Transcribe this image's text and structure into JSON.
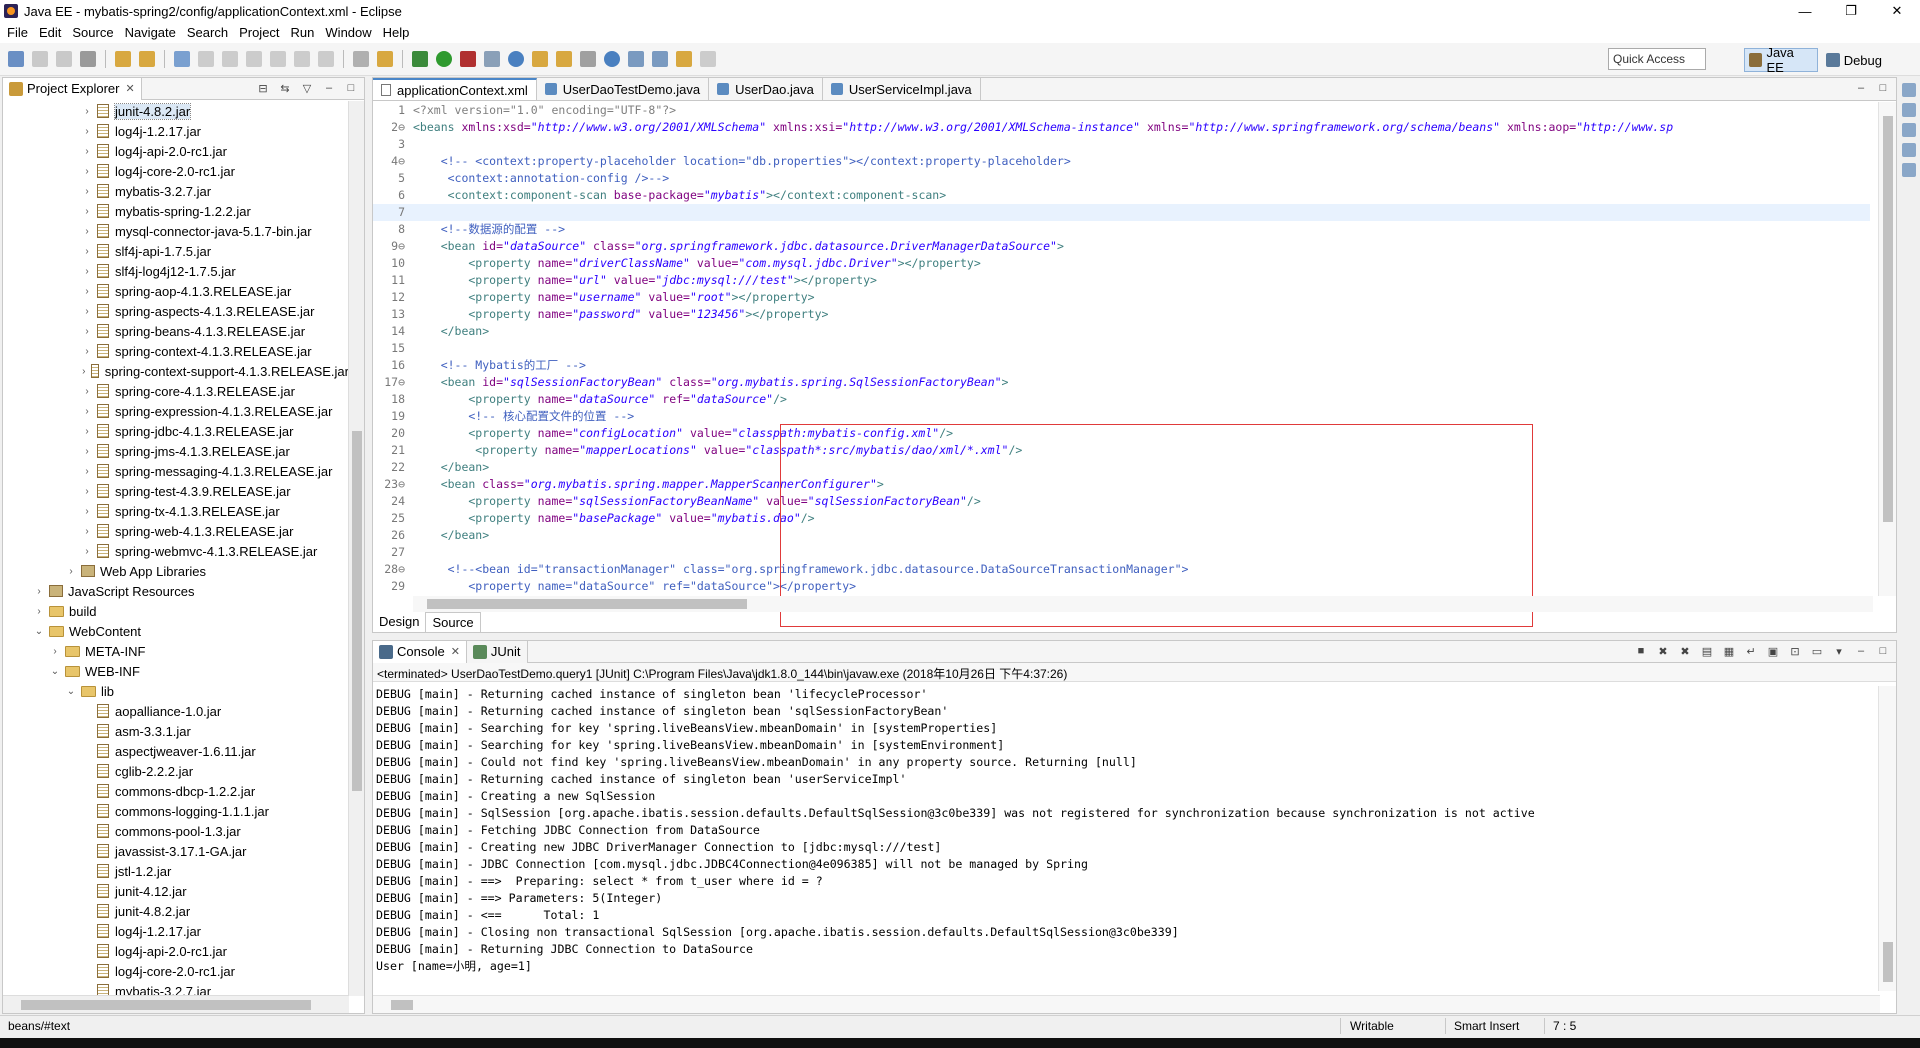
{
  "window": {
    "title": "Java EE - mybatis-spring2/config/applicationContext.xml - Eclipse",
    "min": "—",
    "max": "❐",
    "close": "✕"
  },
  "menu": [
    "File",
    "Edit",
    "Source",
    "Navigate",
    "Search",
    "Project",
    "Run",
    "Window",
    "Help"
  ],
  "toolbar": {
    "quick_access": "Quick Access",
    "perspective_javaee": "Java EE",
    "perspective_debug": "Debug"
  },
  "explorer": {
    "title": "Project Explorer",
    "items": [
      {
        "label": "junit-4.8.2.jar",
        "depth": 4,
        "type": "jar",
        "arrow": "›"
      },
      {
        "label": "log4j-1.2.17.jar",
        "depth": 4,
        "type": "jar",
        "arrow": "›"
      },
      {
        "label": "log4j-api-2.0-rc1.jar",
        "depth": 4,
        "type": "jar",
        "arrow": "›"
      },
      {
        "label": "log4j-core-2.0-rc1.jar",
        "depth": 4,
        "type": "jar",
        "arrow": "›"
      },
      {
        "label": "mybatis-3.2.7.jar",
        "depth": 4,
        "type": "jar",
        "arrow": "›"
      },
      {
        "label": "mybatis-spring-1.2.2.jar",
        "depth": 4,
        "type": "jar",
        "arrow": "›"
      },
      {
        "label": "mysql-connector-java-5.1.7-bin.jar",
        "depth": 4,
        "type": "jar",
        "arrow": "›"
      },
      {
        "label": "slf4j-api-1.7.5.jar",
        "depth": 4,
        "type": "jar",
        "arrow": "›"
      },
      {
        "label": "slf4j-log4j12-1.7.5.jar",
        "depth": 4,
        "type": "jar",
        "arrow": "›"
      },
      {
        "label": "spring-aop-4.1.3.RELEASE.jar",
        "depth": 4,
        "type": "jar",
        "arrow": "›"
      },
      {
        "label": "spring-aspects-4.1.3.RELEASE.jar",
        "depth": 4,
        "type": "jar",
        "arrow": "›"
      },
      {
        "label": "spring-beans-4.1.3.RELEASE.jar",
        "depth": 4,
        "type": "jar",
        "arrow": "›"
      },
      {
        "label": "spring-context-4.1.3.RELEASE.jar",
        "depth": 4,
        "type": "jar",
        "arrow": "›"
      },
      {
        "label": "spring-context-support-4.1.3.RELEASE.jar",
        "depth": 4,
        "type": "jar",
        "arrow": "›"
      },
      {
        "label": "spring-core-4.1.3.RELEASE.jar",
        "depth": 4,
        "type": "jar",
        "arrow": "›"
      },
      {
        "label": "spring-expression-4.1.3.RELEASE.jar",
        "depth": 4,
        "type": "jar",
        "arrow": "›"
      },
      {
        "label": "spring-jdbc-4.1.3.RELEASE.jar",
        "depth": 4,
        "type": "jar",
        "arrow": "›"
      },
      {
        "label": "spring-jms-4.1.3.RELEASE.jar",
        "depth": 4,
        "type": "jar",
        "arrow": "›"
      },
      {
        "label": "spring-messaging-4.1.3.RELEASE.jar",
        "depth": 4,
        "type": "jar",
        "arrow": "›"
      },
      {
        "label": "spring-test-4.3.9.RELEASE.jar",
        "depth": 4,
        "type": "jar",
        "arrow": "›"
      },
      {
        "label": "spring-tx-4.1.3.RELEASE.jar",
        "depth": 4,
        "type": "jar",
        "arrow": "›"
      },
      {
        "label": "spring-web-4.1.3.RELEASE.jar",
        "depth": 4,
        "type": "jar",
        "arrow": "›"
      },
      {
        "label": "spring-webmvc-4.1.3.RELEASE.jar",
        "depth": 4,
        "type": "jar",
        "arrow": "›"
      },
      {
        "label": "Web App Libraries",
        "depth": 3,
        "type": "libs",
        "arrow": "›"
      },
      {
        "label": "JavaScript Resources",
        "depth": 1,
        "type": "libs",
        "arrow": "›"
      },
      {
        "label": "build",
        "depth": 1,
        "type": "folder",
        "arrow": "›"
      },
      {
        "label": "WebContent",
        "depth": 1,
        "type": "folder",
        "arrow": "⌄"
      },
      {
        "label": "META-INF",
        "depth": 2,
        "type": "folder",
        "arrow": "›"
      },
      {
        "label": "WEB-INF",
        "depth": 2,
        "type": "folder",
        "arrow": "⌄"
      },
      {
        "label": "lib",
        "depth": 3,
        "type": "folder",
        "arrow": "⌄"
      },
      {
        "label": "aopalliance-1.0.jar",
        "depth": 4,
        "type": "jar",
        "arrow": ""
      },
      {
        "label": "asm-3.3.1.jar",
        "depth": 4,
        "type": "jar",
        "arrow": ""
      },
      {
        "label": "aspectjweaver-1.6.11.jar",
        "depth": 4,
        "type": "jar",
        "arrow": ""
      },
      {
        "label": "cglib-2.2.2.jar",
        "depth": 4,
        "type": "jar",
        "arrow": ""
      },
      {
        "label": "commons-dbcp-1.2.2.jar",
        "depth": 4,
        "type": "jar",
        "arrow": ""
      },
      {
        "label": "commons-logging-1.1.1.jar",
        "depth": 4,
        "type": "jar",
        "arrow": ""
      },
      {
        "label": "commons-pool-1.3.jar",
        "depth": 4,
        "type": "jar",
        "arrow": ""
      },
      {
        "label": "javassist-3.17.1-GA.jar",
        "depth": 4,
        "type": "jar",
        "arrow": ""
      },
      {
        "label": "jstl-1.2.jar",
        "depth": 4,
        "type": "jar",
        "arrow": ""
      },
      {
        "label": "junit-4.12.jar",
        "depth": 4,
        "type": "jar",
        "arrow": ""
      },
      {
        "label": "junit-4.8.2.jar",
        "depth": 4,
        "type": "jar",
        "arrow": ""
      },
      {
        "label": "log4j-1.2.17.jar",
        "depth": 4,
        "type": "jar",
        "arrow": ""
      },
      {
        "label": "log4j-api-2.0-rc1.jar",
        "depth": 4,
        "type": "jar",
        "arrow": ""
      },
      {
        "label": "log4j-core-2.0-rc1.jar",
        "depth": 4,
        "type": "jar",
        "arrow": ""
      },
      {
        "label": "mybatis-3.2.7.jar",
        "depth": 4,
        "type": "jar",
        "arrow": ""
      }
    ]
  },
  "editor": {
    "tabs": [
      {
        "label": "applicationContext.xml",
        "active": true,
        "icon": "xml-file-icon"
      },
      {
        "label": "UserDaoTestDemo.java",
        "active": false,
        "icon": "java-file-icon"
      },
      {
        "label": "UserDao.java",
        "active": false,
        "icon": "java-file-icon"
      },
      {
        "label": "UserServiceImpl.java",
        "active": false,
        "icon": "java-file-icon"
      }
    ],
    "bottom_tabs": [
      "Design",
      "Source"
    ],
    "lines": [
      {
        "n": "1",
        "t": [
          [
            "pi",
            "<?xml version=\"1.0\" encoding=\"UTF-8\"?>"
          ]
        ]
      },
      {
        "n": "2⊖",
        "t": [
          [
            "tag",
            "<beans "
          ],
          [
            "att",
            "xmlns:xsd="
          ],
          [
            "str",
            "\"http://www.w3.org/2001/XMLSchema\""
          ],
          [
            "att",
            " xmlns:xsi="
          ],
          [
            "str",
            "\"http://www.w3.org/2001/XMLSchema-instance\""
          ],
          [
            "att",
            " xmlns="
          ],
          [
            "str",
            "\"http://www.springframework.org/schema/beans\""
          ],
          [
            "att",
            " xmlns:aop="
          ],
          [
            "str",
            "\"http://www.sp"
          ]
        ]
      },
      {
        "n": "3",
        "t": []
      },
      {
        "n": "4⊖",
        "t": [
          [
            "com",
            "    <!-- <context:property-placeholder location=\"db.properties\"></context:property-placeholder>"
          ]
        ]
      },
      {
        "n": "5",
        "t": [
          [
            "com",
            "     <context:annotation-config />-->"
          ]
        ]
      },
      {
        "n": "6",
        "t": [
          [
            "tag",
            "     <context:component-scan "
          ],
          [
            "att",
            "base-package="
          ],
          [
            "str",
            "\"mybatis\""
          ],
          [
            "tag",
            "></context:component-scan>"
          ]
        ]
      },
      {
        "n": "7",
        "t": [],
        "cur": true
      },
      {
        "n": "8",
        "t": [
          [
            "com",
            "    <!--数据源的配置 -->"
          ]
        ]
      },
      {
        "n": "9⊖",
        "t": [
          [
            "tag",
            "    <bean "
          ],
          [
            "att",
            "id="
          ],
          [
            "str",
            "\"dataSource\""
          ],
          [
            "att",
            " class="
          ],
          [
            "str",
            "\"org.springframework.jdbc.datasource.DriverManagerDataSource\""
          ],
          [
            "tag",
            ">"
          ]
        ]
      },
      {
        "n": "10",
        "t": [
          [
            "tag",
            "        <property "
          ],
          [
            "att",
            "name="
          ],
          [
            "str",
            "\"driverClassName\""
          ],
          [
            "att",
            " value="
          ],
          [
            "str",
            "\"com.mysql.jdbc.Driver\""
          ],
          [
            "tag",
            "></property>"
          ]
        ]
      },
      {
        "n": "11",
        "t": [
          [
            "tag",
            "        <property "
          ],
          [
            "att",
            "name="
          ],
          [
            "str",
            "\"url\""
          ],
          [
            "att",
            " value="
          ],
          [
            "str",
            "\"jdbc:mysql:///test\""
          ],
          [
            "tag",
            "></property>"
          ]
        ]
      },
      {
        "n": "12",
        "t": [
          [
            "tag",
            "        <property "
          ],
          [
            "att",
            "name="
          ],
          [
            "str",
            "\"username\""
          ],
          [
            "att",
            " value="
          ],
          [
            "str",
            "\"root\""
          ],
          [
            "tag",
            "></property>"
          ]
        ]
      },
      {
        "n": "13",
        "t": [
          [
            "tag",
            "        <property "
          ],
          [
            "att",
            "name="
          ],
          [
            "str",
            "\"password\""
          ],
          [
            "att",
            " value="
          ],
          [
            "str",
            "\"123456\""
          ],
          [
            "tag",
            "></property>"
          ]
        ]
      },
      {
        "n": "14",
        "t": [
          [
            "tag",
            "    </bean>"
          ]
        ]
      },
      {
        "n": "15",
        "t": []
      },
      {
        "n": "16",
        "t": [
          [
            "com",
            "    <!-- Mybatis的工厂 -->"
          ]
        ]
      },
      {
        "n": "17⊖",
        "t": [
          [
            "tag",
            "    <bean "
          ],
          [
            "att",
            "id="
          ],
          [
            "str",
            "\"sqlSessionFactoryBean\""
          ],
          [
            "att",
            " class="
          ],
          [
            "str",
            "\"org.mybatis.spring.SqlSessionFactoryBean\""
          ],
          [
            "tag",
            ">"
          ]
        ]
      },
      {
        "n": "18",
        "t": [
          [
            "tag",
            "        <property "
          ],
          [
            "att",
            "name="
          ],
          [
            "str",
            "\"dataSource\""
          ],
          [
            "att",
            " ref="
          ],
          [
            "str",
            "\"dataSource\""
          ],
          [
            "tag",
            "/>"
          ]
        ]
      },
      {
        "n": "19",
        "t": [
          [
            "com",
            "        <!-- 核心配置文件的位置 -->"
          ]
        ]
      },
      {
        "n": "20",
        "t": [
          [
            "tag",
            "        <property "
          ],
          [
            "att",
            "name="
          ],
          [
            "str",
            "\"configLocation\""
          ],
          [
            "att",
            " value="
          ],
          [
            "str",
            "\"classpath:mybatis-config.xml\""
          ],
          [
            "tag",
            "/>"
          ]
        ]
      },
      {
        "n": "21",
        "t": [
          [
            "tag",
            "         <property "
          ],
          [
            "att",
            "name="
          ],
          [
            "str",
            "\"mapperLocations\""
          ],
          [
            "att",
            " value="
          ],
          [
            "str",
            "\"classpath*:src/mybatis/dao/xml/*.xml\""
          ],
          [
            "tag",
            "/>"
          ]
        ]
      },
      {
        "n": "22",
        "t": [
          [
            "tag",
            "    </bean>"
          ]
        ]
      },
      {
        "n": "23⊖",
        "t": [
          [
            "tag",
            "    <bean "
          ],
          [
            "att",
            "class="
          ],
          [
            "str",
            "\"org.mybatis.spring.mapper.MapperScannerConfigurer\""
          ],
          [
            "tag",
            ">"
          ]
        ]
      },
      {
        "n": "24",
        "t": [
          [
            "tag",
            "        <property "
          ],
          [
            "att",
            "name="
          ],
          [
            "str",
            "\"sqlSessionFactoryBeanName\""
          ],
          [
            "att",
            " value="
          ],
          [
            "str",
            "\"sqlSessionFactoryBean\""
          ],
          [
            "tag",
            "/>"
          ]
        ]
      },
      {
        "n": "25",
        "t": [
          [
            "tag",
            "        <property "
          ],
          [
            "att",
            "name="
          ],
          [
            "str",
            "\"basePackage\""
          ],
          [
            "att",
            " value="
          ],
          [
            "str",
            "\"mybatis.dao\""
          ],
          [
            "tag",
            "/>"
          ]
        ]
      },
      {
        "n": "26",
        "t": [
          [
            "tag",
            "    </bean>"
          ]
        ]
      },
      {
        "n": "27",
        "t": []
      },
      {
        "n": "28⊖",
        "t": [
          [
            "com",
            "     <!--<bean id=\"transactionManager\" class=\"org.springframework.jdbc.datasource.DataSourceTransactionManager\">"
          ]
        ]
      },
      {
        "n": "29",
        "t": [
          [
            "com",
            "        <property name=\"dataSource\" ref=\"dataSource\"></property>"
          ]
        ]
      }
    ]
  },
  "console": {
    "tabs": [
      "Console",
      "JUnit"
    ],
    "header": "<terminated> UserDaoTestDemo.query1 [JUnit] C:\\Program Files\\Java\\jdk1.8.0_144\\bin\\javaw.exe (2018年10月26日 下午4:37:26)",
    "lines": [
      "DEBUG [main] - Returning cached instance of singleton bean 'lifecycleProcessor'",
      "DEBUG [main] - Returning cached instance of singleton bean 'sqlSessionFactoryBean'",
      "DEBUG [main] - Searching for key 'spring.liveBeansView.mbeanDomain' in [systemProperties]",
      "DEBUG [main] - Searching for key 'spring.liveBeansView.mbeanDomain' in [systemEnvironment]",
      "DEBUG [main] - Could not find key 'spring.liveBeansView.mbeanDomain' in any property source. Returning [null]",
      "DEBUG [main] - Returning cached instance of singleton bean 'userServiceImpl'",
      "DEBUG [main] - Creating a new SqlSession",
      "DEBUG [main] - SqlSession [org.apache.ibatis.session.defaults.DefaultSqlSession@3c0be339] was not registered for synchronization because synchronization is not active",
      "DEBUG [main] - Fetching JDBC Connection from DataSource",
      "DEBUG [main] - Creating new JDBC DriverManager Connection to [jdbc:mysql:///test]",
      "DEBUG [main] - JDBC Connection [com.mysql.jdbc.JDBC4Connection@4e096385] will not be managed by Spring",
      "DEBUG [main] - ==>  Preparing: select * from t_user where id = ?",
      "DEBUG [main] - ==> Parameters: 5(Integer)",
      "DEBUG [main] - <==      Total: 1",
      "DEBUG [main] - Closing non transactional SqlSession [org.apache.ibatis.session.defaults.DefaultSqlSession@3c0be339]",
      "DEBUG [main] - Returning JDBC Connection to DataSource",
      "User [name=小明, age=1]"
    ]
  },
  "status": {
    "path": "beans/#text",
    "writable": "Writable",
    "insert_mode": "Smart Insert",
    "position": "7 : 5"
  },
  "colors": {
    "accent": "#4a86c8",
    "highlight_box": "#e03a3a",
    "xml_tag": "#3f7f7f",
    "xml_attr": "#7f007f",
    "xml_string": "#2a00ff",
    "xml_comment": "#3f5fbf"
  }
}
